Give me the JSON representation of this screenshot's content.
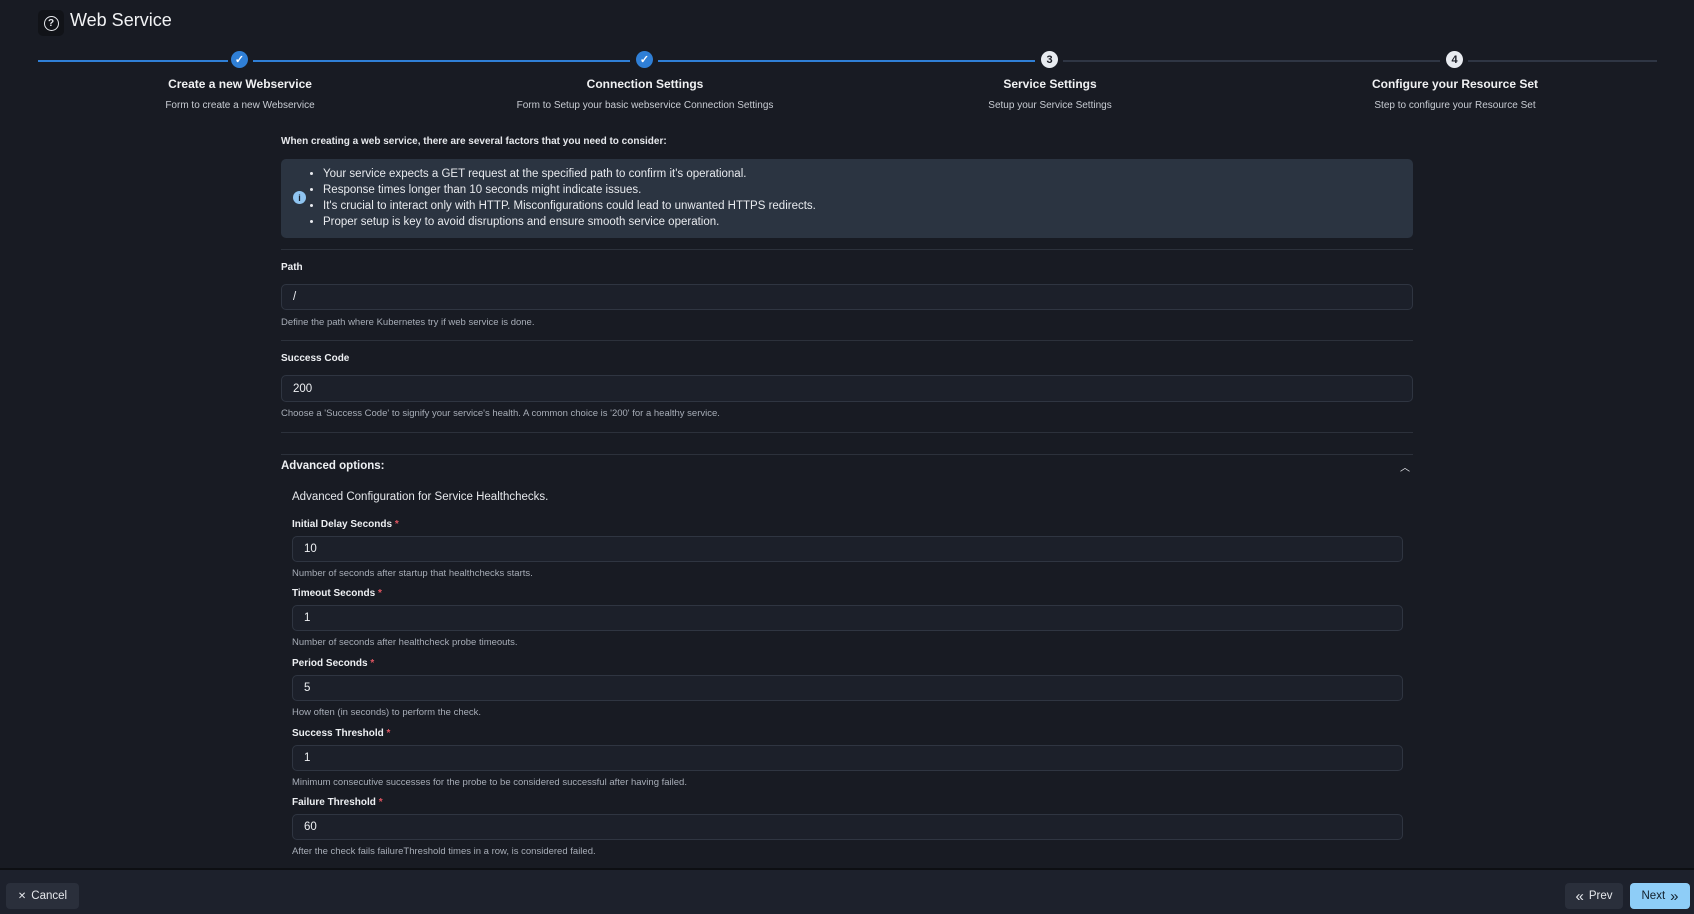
{
  "header": {
    "title": "Web Service",
    "icon": "help-circle-icon"
  },
  "stepper": {
    "steps": [
      {
        "title": "Create a new Webservice",
        "description": "Form to create a new Webservice",
        "status": "done"
      },
      {
        "title": "Connection Settings",
        "description": "Form to Setup your basic webservice Connection Settings",
        "status": "done"
      },
      {
        "title": "Service Settings",
        "description": "Setup your Service Settings",
        "status": "current",
        "number": "3"
      },
      {
        "title": "Configure your Resource Set",
        "description": "Step to configure your Resource Set",
        "status": "pending",
        "number": "4"
      }
    ],
    "accent": "#2f7fd6"
  },
  "info": {
    "heading": "When creating a web service, there are several factors that you need to consider:",
    "items": [
      "Your service expects a GET request at the specified path to confirm it's operational.",
      "Response times longer than 10 seconds might indicate issues.",
      "It's crucial to interact only with HTTP. Misconfigurations could lead to unwanted HTTPS redirects.",
      "Proper setup is key to avoid disruptions and ensure smooth service operation."
    ]
  },
  "fields": {
    "path": {
      "label": "Path",
      "value": "/",
      "help": "Define the path where Kubernetes try if web service is done."
    },
    "success_code": {
      "label": "Success Code",
      "value": "200",
      "help": "Choose a 'Success Code' to signify your service's health. A common choice is '200' for a healthy service."
    }
  },
  "advanced": {
    "title": "Advanced options:",
    "expanded": true,
    "description": "Advanced Configuration for Service Healthchecks.",
    "fields": [
      {
        "label": "Initial Delay Seconds",
        "value": "10",
        "help": "Number of seconds after startup that healthchecks starts."
      },
      {
        "label": "Timeout Seconds",
        "value": "1",
        "help": "Number of seconds after healthcheck probe timeouts."
      },
      {
        "label": "Period Seconds",
        "value": "5",
        "help": "How often (in seconds) to perform the check."
      },
      {
        "label": "Success Threshold",
        "value": "1",
        "help": "Minimum consecutive successes for the probe to be considered successful after having failed."
      },
      {
        "label": "Failure Threshold",
        "value": "60",
        "help": "After the check fails failureThreshold times in a row, is considered failed."
      }
    ],
    "required_mark": "*"
  },
  "footer": {
    "cancel": "Cancel",
    "prev": "Prev",
    "next": "Next",
    "next_color": "#8ecdf7"
  }
}
